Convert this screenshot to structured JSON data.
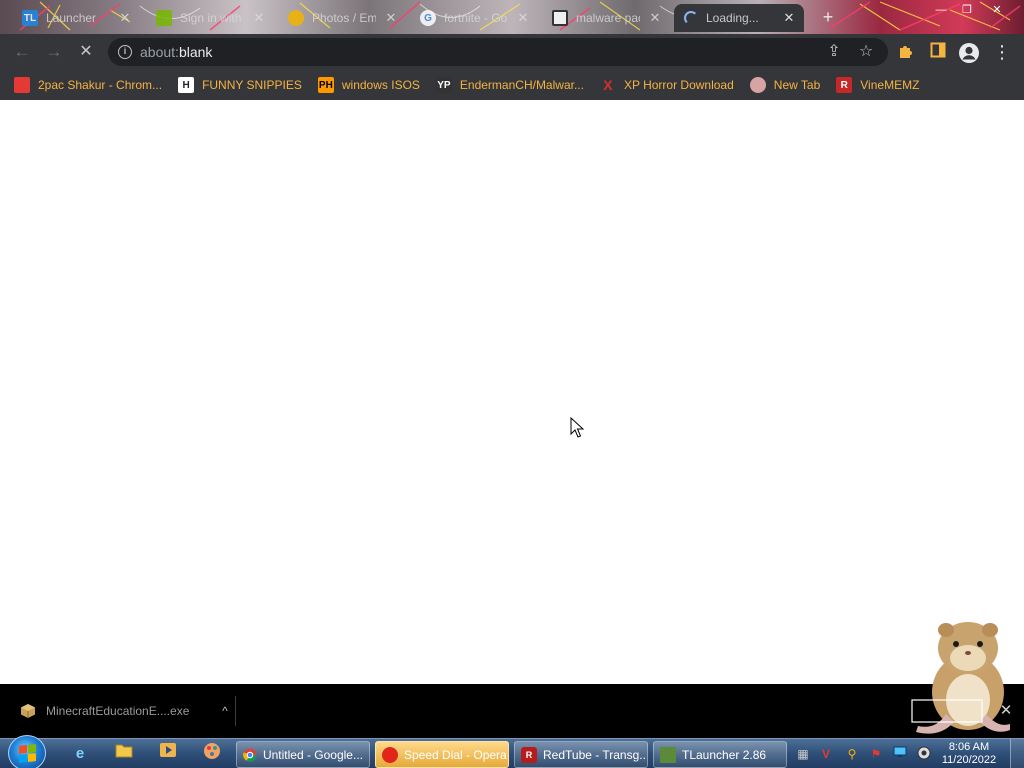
{
  "browser": {
    "tabs": [
      {
        "title": "Launcher",
        "favicon": "tlauncher-icon",
        "favicon_text": "TL",
        "favicon_color": "#1e88e5"
      },
      {
        "title": "Sign in with",
        "favicon": "nvidia-icon",
        "favicon_text": "",
        "favicon_color": "#76b900"
      },
      {
        "title": "Photos / Embo",
        "favicon": "photos-icon",
        "favicon_text": "",
        "favicon_color": "#f4b400"
      },
      {
        "title": "fortnite - Go",
        "favicon": "google-icon",
        "favicon_text": "G",
        "favicon_color": "#ffffff"
      },
      {
        "title": "malware pac",
        "favicon": "archive-icon",
        "favicon_text": "",
        "favicon_color": "#ffffff"
      },
      {
        "title": "Loading...",
        "favicon": "loading-spinner",
        "favicon_text": "",
        "favicon_color": "#8ab4f8",
        "active": true
      }
    ],
    "new_tab_glyph": "+",
    "omnibox": {
      "scheme": "about:",
      "host": "blank"
    },
    "bookmarks": [
      {
        "label": "2pac Shakur - Chrom...",
        "icon": "chrome-web-store-icon",
        "icon_text": "",
        "icon_color": "#e53935"
      },
      {
        "label": "FUNNY SNIPPIES",
        "icon": "h-letter-icon",
        "icon_text": "H",
        "icon_color": "#222222"
      },
      {
        "label": "windows ISOS",
        "icon": "ph-icon",
        "icon_text": "PH",
        "icon_color": "#ff9900"
      },
      {
        "label": "EndermanCH/Malwar...",
        "icon": "yp-icon",
        "icon_text": "YP",
        "icon_color": "#333333"
      },
      {
        "label": "XP Horror Download",
        "icon": "x-letter-icon",
        "icon_text": "X",
        "icon_color": "#d32f2f"
      },
      {
        "label": "New Tab",
        "icon": "new-tab-icon",
        "icon_text": "",
        "icon_color": "#b07070"
      },
      {
        "label": "VineMEMZ",
        "icon": "r-letter-icon",
        "icon_text": "R",
        "icon_color": "#c62828"
      }
    ]
  },
  "downloads": {
    "file_name": "MinecraftEducationE....exe",
    "chevron": "^",
    "close": "✕"
  },
  "taskbar": {
    "windows": [
      {
        "label": "Untitled - Google...",
        "icon": "chrome-icon",
        "icon_color": "#e53935",
        "active": true
      },
      {
        "label": "Speed Dial - Opera",
        "icon": "opera-icon",
        "icon_color": "#e1251b",
        "highlight": true
      },
      {
        "label": "RedTube - Transg...",
        "icon": "redtube-icon",
        "icon_color": "#b71c1c"
      },
      {
        "label": "TLauncher 2.86",
        "icon": "minecraft-block-icon",
        "icon_color": "#5d8a3a"
      }
    ],
    "clock": {
      "time": "8:06 AM",
      "date": "11/20/2022"
    }
  }
}
